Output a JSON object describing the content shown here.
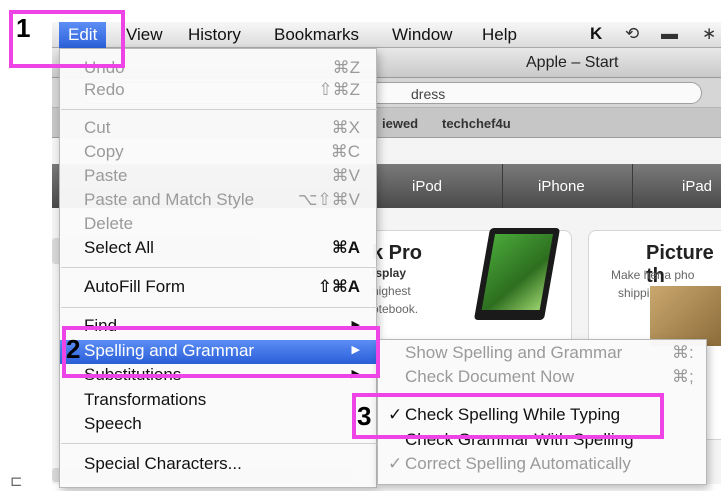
{
  "menubar": {
    "items": [
      "Edit",
      "View",
      "History",
      "Bookmarks",
      "Window",
      "Help"
    ],
    "status_icons": [
      "k-icon",
      "clock-icon",
      "monitor-icon",
      "bluetooth-icon"
    ],
    "status_glyphs": [
      "K",
      "⟲",
      "▬",
      "∗"
    ]
  },
  "browser": {
    "window_title": "Apple – Start",
    "address_placeholder": "dress",
    "bookmarks": [
      "iewed",
      "techchef4u"
    ],
    "nav_tabs": [
      "iPod",
      "iPhone",
      "iPad"
    ],
    "card_left": {
      "title": "k Pro",
      "sub": "isplay",
      "text_lines": [
        "highest",
        "otebook."
      ]
    },
    "card_right": {
      "title": "Picture th",
      "text_lines": [
        "Make her a pho",
        "shipping in tim"
      ]
    }
  },
  "edit_menu": {
    "undo": {
      "label": "Undo",
      "shortcut": "⌘Z"
    },
    "redo": {
      "label": "Redo",
      "shortcut": "⇧⌘Z"
    },
    "cut": {
      "label": "Cut",
      "shortcut": "⌘X"
    },
    "copy": {
      "label": "Copy",
      "shortcut": "⌘C"
    },
    "paste": {
      "label": "Paste",
      "shortcut": "⌘V"
    },
    "paste_match": {
      "label": "Paste and Match Style",
      "shortcut": "⌥⇧⌘V"
    },
    "delete": {
      "label": "Delete"
    },
    "select_all": {
      "label": "Select All",
      "shortcut": "⌘A"
    },
    "autofill": {
      "label": "AutoFill Form",
      "shortcut": "⇧⌘A"
    },
    "find": {
      "label": "Find"
    },
    "spelling": {
      "label": "Spelling and Grammar"
    },
    "substitutions": {
      "label": "Substitutions"
    },
    "transformations": {
      "label": "Transformations"
    },
    "speech": {
      "label": "Speech"
    },
    "special_chars": {
      "label": "Special Characters..."
    },
    "submenu_arrow": "▶"
  },
  "spelling_submenu": {
    "show": {
      "label": "Show Spelling and Grammar",
      "shortcut": "⌘:"
    },
    "check_now": {
      "label": "Check Document Now",
      "shortcut": "⌘;"
    },
    "check_while_typing": {
      "label": "Check Spelling While Typing",
      "checkmark": "✓"
    },
    "check_grammar": {
      "label": "Check Grammar With Spelling"
    },
    "correct_auto": {
      "label": "Correct Spelling Automatically",
      "checkmark": "✓"
    }
  },
  "annotations": {
    "step1": "1",
    "step2": "2",
    "step3": "3",
    "highlight_color": "#ee44e6"
  },
  "corner_glyph": "⊏"
}
